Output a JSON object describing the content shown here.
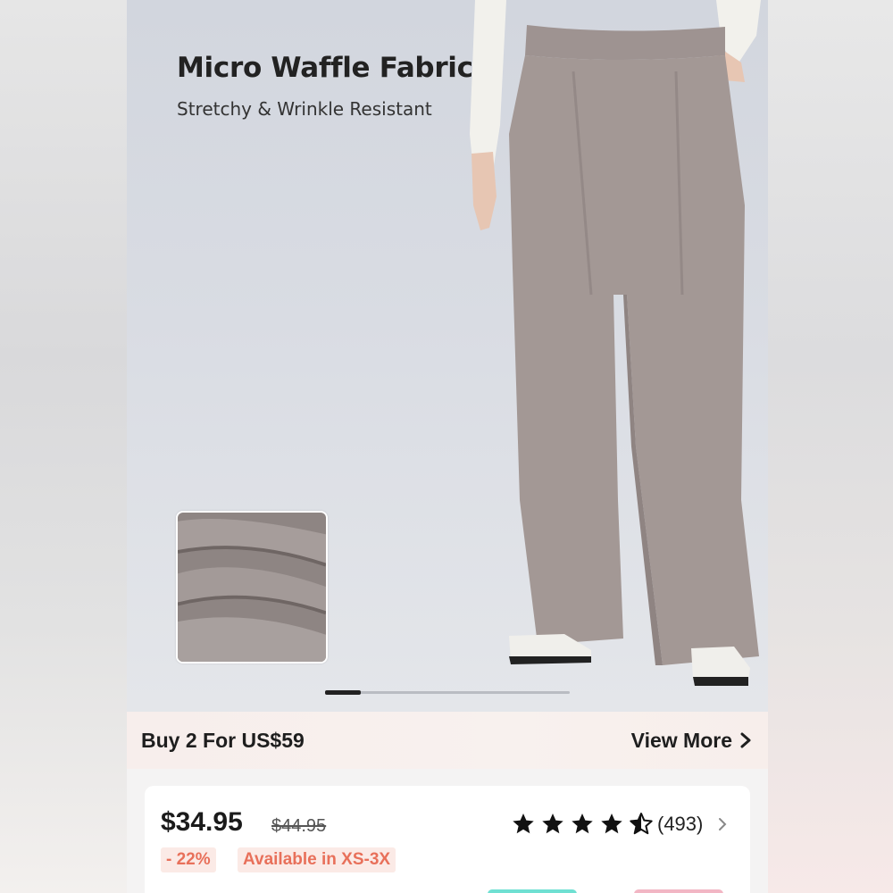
{
  "hero": {
    "title": "Micro Waffle Fabric",
    "subtitle": "Stretchy & Wrinkle Resistant",
    "image": "model-wearing-wide-leg-pants",
    "swatch": "fabric-closeup-swatch",
    "pants_color": "#a39895",
    "carousel": {
      "current": 1,
      "total": 7
    }
  },
  "promo": {
    "text": "Buy 2 For US$59",
    "link": "View More",
    "link_icon": "chevron-right-icon"
  },
  "product": {
    "price": "$34.95",
    "original_price": "$44.95",
    "discount": "- 22%",
    "availability": "Available in XS-3X",
    "rating": 4.5,
    "review_count": "(493)",
    "rating_icon": "chevron-right-icon"
  },
  "colors": {
    "accent": "#e8705a",
    "badge_bg": "#fbeae6",
    "promo_bg": "#f7eeec"
  }
}
